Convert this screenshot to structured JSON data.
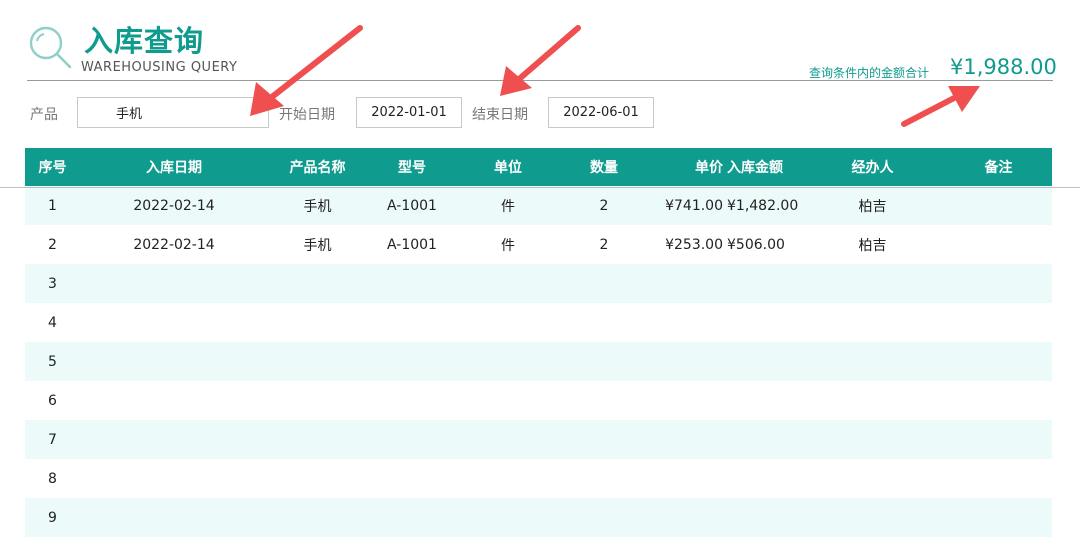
{
  "header": {
    "title": "入库查询",
    "subtitle": "WAREHOUSING  QUERY",
    "total_label": "查询条件内的金额合计",
    "total_value": "¥1,988.00"
  },
  "filters": {
    "product_label": "产品",
    "product_value": "手机",
    "start_label": "开始日期",
    "start_value": "2022-01-01",
    "end_label": "结束日期",
    "end_value": "2022-06-01"
  },
  "table": {
    "headers": [
      "序号",
      "入库日期",
      "产品名称",
      "型号",
      "单位",
      "数量",
      "单价",
      "入库金额",
      "经办人",
      "备注"
    ],
    "rows": [
      [
        "1",
        "2022-02-14",
        "手机",
        "A-1001",
        "件",
        "2",
        "¥741.00",
        "¥1,482.00",
        "柏吉",
        ""
      ],
      [
        "2",
        "2022-02-14",
        "手机",
        "A-1001",
        "件",
        "2",
        "¥253.00",
        "¥506.00",
        "柏吉",
        ""
      ],
      [
        "3",
        "",
        "",
        "",
        "",
        "",
        "",
        "",
        "",
        ""
      ],
      [
        "4",
        "",
        "",
        "",
        "",
        "",
        "",
        "",
        "",
        ""
      ],
      [
        "5",
        "",
        "",
        "",
        "",
        "",
        "",
        "",
        "",
        ""
      ],
      [
        "6",
        "",
        "",
        "",
        "",
        "",
        "",
        "",
        "",
        ""
      ],
      [
        "7",
        "",
        "",
        "",
        "",
        "",
        "",
        "",
        "",
        ""
      ],
      [
        "8",
        "",
        "",
        "",
        "",
        "",
        "",
        "",
        "",
        ""
      ],
      [
        "9",
        "",
        "",
        "",
        "",
        "",
        "",
        "",
        "",
        ""
      ]
    ]
  },
  "colors": {
    "accent": "#0f9b8e",
    "row_tint": "#ecfbfa",
    "annotation_arrow": "#ef4f4f"
  },
  "icons": {
    "logo": "magnifier-icon",
    "annotation": "red-arrow-icon"
  }
}
